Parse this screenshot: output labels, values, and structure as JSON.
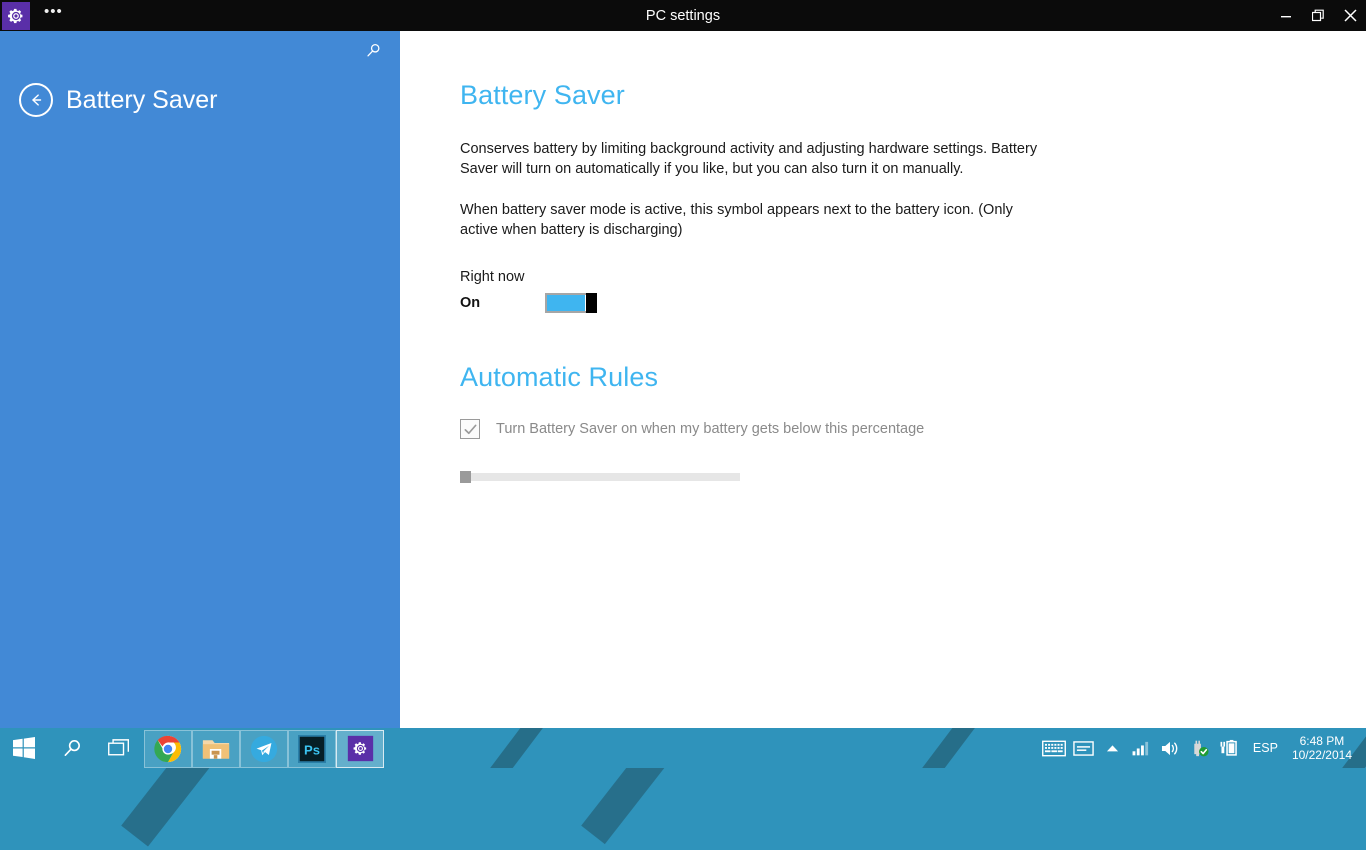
{
  "window": {
    "title": "PC settings",
    "app_icon": "gear-icon",
    "ellipsis": "•••",
    "controls": {
      "minimize": "—",
      "maximize": "❐",
      "close": "✕"
    }
  },
  "sidebar": {
    "title": "Battery Saver",
    "back_icon": "back-arrow-icon",
    "search_icon": "search-icon",
    "background_color": "#4289d6"
  },
  "content": {
    "heading": "Battery Saver",
    "description_1": "Conserves battery by limiting background activity and adjusting hardware settings. Battery Saver will turn on automatically if you like, but you can also turn it on manually.",
    "description_2": "When battery saver mode is active, this symbol appears next to the battery icon. (Only active when battery is discharging)",
    "right_now_label": "Right now",
    "toggle_state": "On",
    "toggle_on": true,
    "automatic_rules_heading": "Automatic Rules",
    "rule_checkbox_label": "Turn Battery Saver on when my battery gets below this percentage",
    "rule_checkbox_checked": true,
    "slider_value": 0,
    "accent_color": "#3fb5f0",
    "heading_color": "#3fb5f0"
  },
  "taskbar": {
    "start": "start-button",
    "search": "search-button",
    "task_view": "task-view-button",
    "apps": [
      {
        "name": "chrome",
        "label": "Google Chrome",
        "active": false
      },
      {
        "name": "file-explorer",
        "label": "File Explorer",
        "active": false
      },
      {
        "name": "telegram",
        "label": "Telegram",
        "active": false
      },
      {
        "name": "photoshop",
        "label": "Ps",
        "active": false
      },
      {
        "name": "pc-settings",
        "label": "PC settings",
        "active": true
      }
    ],
    "tray": {
      "icons": [
        "on-screen-keyboard-icon",
        "handwriting-panel-icon",
        "show-hidden-icons-icon",
        "network-signal-icon",
        "volume-icon",
        "usb-safely-remove-icon",
        "battery-saver-icon"
      ],
      "language": "ESP",
      "time": "6:48 PM",
      "date": "10/22/2014"
    }
  }
}
